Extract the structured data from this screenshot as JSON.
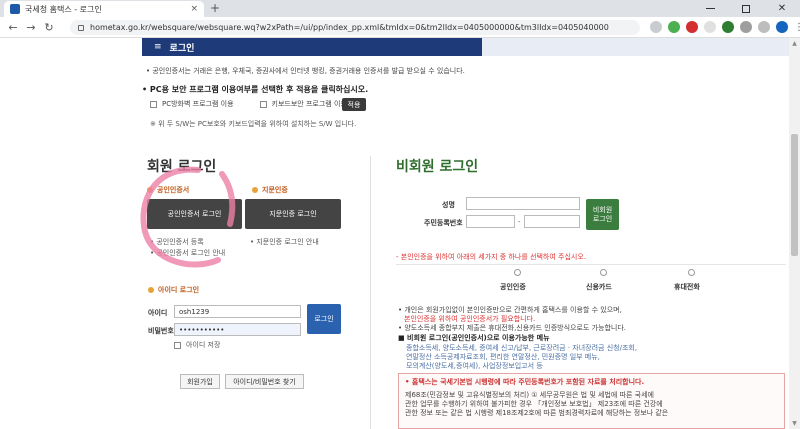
{
  "browser": {
    "tab_title": "국세청 홈택스 - 로그인",
    "tab_close": "×",
    "new_tab": "+",
    "url": "hometax.go.kr/websquare/websquare.wq?w2xPath=/ui/pp/index_pp.xml&tmIdx=0&tm2lIdx=0405000000&tm3lIdx=0405040000"
  },
  "header": {
    "menu_glyph": "≡",
    "title": "로그인"
  },
  "notice": "• 공인인증서는 거래은 은행, 우체국, 증권사에서 인터넷 뱅킹, 증권거래용 인증서를 발급 받으실 수 있습니다.",
  "pc_security": {
    "title": "• PC용 보안 프로그램 이용여부를 선택한 후 적용을 클릭하십시오.",
    "option1": "PC방화벽 프로그램 이용",
    "option2": "키보드보안 프로그램 이용",
    "apply": "적용",
    "note": "※ 위 두 S/W는 PC보호와 키보드입력을 위하여 설치하는 S/W 입니다."
  },
  "member": {
    "title": "회원 로그인",
    "cert_label": "공인인증서",
    "cert_button": "공인인증서 로그인",
    "cert_register": "• 공인인증서 등록",
    "cert_guide": "• 공인인증서 로그인 안내",
    "fin_label": "지문인증",
    "fin_button": "지문인증 로그인",
    "fin_guide": "• 지문인증 로그인 안내",
    "id_label": "아이디 로그인",
    "id_field_label": "아이디",
    "id_value": "osh1239",
    "pw_field_label": "비밀번호",
    "pw_value": "•••••••••••",
    "login_button": "로그인",
    "save_id": "아이디 저장",
    "join_button": "회원가입",
    "find_button": "아이디/비밀번호 찾기"
  },
  "nonmember": {
    "title": "비회원 로그인",
    "name_label": "성명",
    "rrn_label": "주민등록번호",
    "rrn_dash": "-",
    "login_button_line1": "비회원",
    "login_button_line2": "로그인",
    "warn": "- 본인인증을 위하여 아래의 세가지 중 하나를 선택하여 주십시오.",
    "auth_options": [
      "공인인증",
      "신용카드",
      "휴대전화"
    ],
    "info_lines": [
      "• 개인은 회원가입없이 본인인증만으로 간편하게 홈택스를 이용할 수 있으며,",
      "본인인증을 위하여 공인인증서가 필요합니다.",
      "• 양도소득세 종합부지 제출은 휴대전화,신용카드 인증방식으로도 가능합니다.",
      "■ 비회원 로그인(공인인증서)으로 이용가능한 메뉴",
      "종합소득세, 양도소득세, 증여세 신고/납부, 근로장려금 · 자녀장려금 신청/조회,",
      "연말정산 소득공제자료조회, 편리한 연말정산, 민원증명 일부 메뉴,",
      "모의계산(양도세,증여세), 사업장정보입고서 등"
    ],
    "box_title": "• 홈택스는 국세기본법 시행령에 따라 주민등록번호가 포함된 자료를 처리합니다.",
    "box_line1": "제68조(민감정보 및 고유식별정보의 처리) ① 세무공무원은 법 및 세법에 따른 국세에",
    "box_line2": "관한 업무를 수행하기 위하여 불가피한 경우 「개인정보 보호법」 제23조에 따른 건강에",
    "box_line3": "관한 정보 또는 같은 법 시행령 제18조제2호에 따른 범죄경력자료에 해당하는 정보나 같은"
  },
  "colors": {
    "header_navy": "#1e3a78",
    "member_orange": "#c05a1a",
    "login_blue": "#2a62b0",
    "nonmember_green": "#2f6e2f",
    "warn_red": "#d33333",
    "annotation_pink": "#ec7fa6"
  }
}
